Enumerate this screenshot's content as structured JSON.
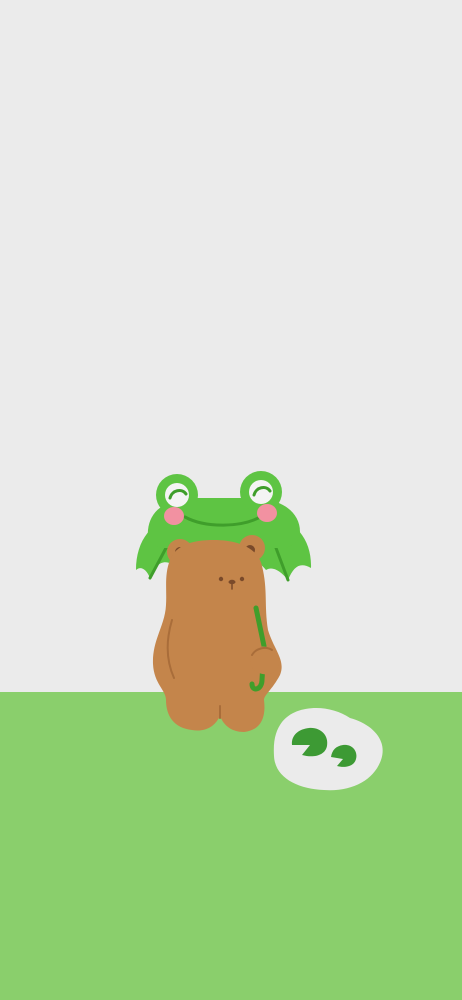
{
  "scene": {
    "description_visible_text": "",
    "colors": {
      "sky": "#ebebeb",
      "ground": "#8acf6c",
      "umbrella_green": "#5ec443",
      "umbrella_dark": "#3f9e2b",
      "frog_eye_white": "#f4f4f4",
      "frog_cheek": "#f291a1",
      "bear_fur": "#c4854b",
      "bear_dark": "#7a4a2a",
      "puddle": "#ebebeb",
      "lily_pad": "#3d9a34"
    },
    "icons": {
      "character": "bear-with-frog-umbrella-icon",
      "puddle": "puddle-with-lily-pads-icon"
    }
  }
}
